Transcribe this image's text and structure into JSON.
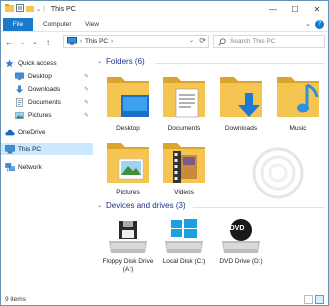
{
  "window": {
    "title": "This PC",
    "quick_access_sep": "|",
    "controls": {
      "minimize": "—",
      "maximize": "☐",
      "close": "✕"
    }
  },
  "ribbon": {
    "tabs": [
      {
        "label": "File"
      },
      {
        "label": "Computer"
      },
      {
        "label": "View"
      }
    ],
    "expand_glyph": "⌄",
    "help_glyph": "?"
  },
  "navigation": {
    "back": "←",
    "forward": "→",
    "recent": "⌄",
    "up": "↑",
    "address_path": "This PC",
    "address_sep": "›",
    "address_dropdown": "⌄",
    "refresh": "⟳",
    "search_placeholder": "Search This PC"
  },
  "nav_pane": {
    "items": [
      {
        "label": "Quick access",
        "icon": "star-icon"
      },
      {
        "label": "Desktop",
        "icon": "desktop-icon",
        "pinned": true
      },
      {
        "label": "Downloads",
        "icon": "download-icon",
        "pinned": true
      },
      {
        "label": "Documents",
        "icon": "documents-icon",
        "pinned": true
      },
      {
        "label": "Pictures",
        "icon": "pictures-icon",
        "pinned": true
      },
      {
        "label": "OneDrive",
        "icon": "cloud-icon"
      },
      {
        "label": "This PC",
        "icon": "computer-icon",
        "selected": true
      },
      {
        "label": "Network",
        "icon": "network-icon"
      }
    ],
    "pin_glyph": "✎"
  },
  "content": {
    "folders_header": "Folders (6)",
    "folders": [
      {
        "label": "Desktop"
      },
      {
        "label": "Documents"
      },
      {
        "label": "Downloads"
      },
      {
        "label": "Music"
      },
      {
        "label": "Pictures"
      },
      {
        "label": "Videos"
      }
    ],
    "drives_header": "Devices and drives (3)",
    "drives": [
      {
        "label": "Floppy Disk Drive (A:)"
      },
      {
        "label": "Local Disk (C:)"
      },
      {
        "label": "DVD Drive (D:)",
        "badge": "DVD"
      }
    ],
    "chevron": "⌄"
  },
  "status": {
    "item_count": "9 items"
  },
  "colors": {
    "accent": "#1979ca",
    "folder": "#f4c550",
    "folder_dark": "#dba42c",
    "header_text": "#1e3287",
    "selection": "#cce8ff"
  }
}
